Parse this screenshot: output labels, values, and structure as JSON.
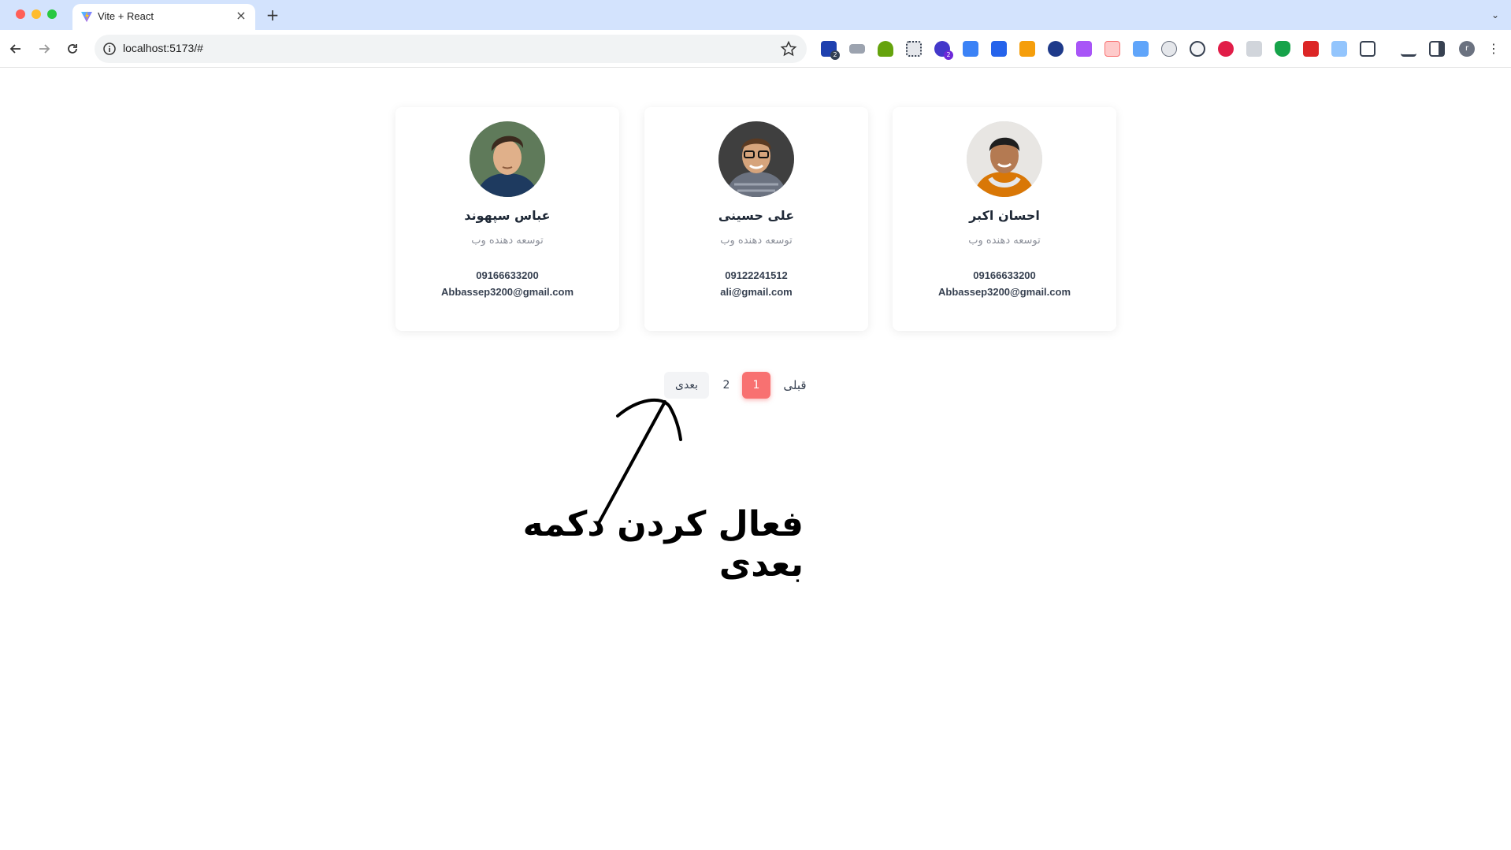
{
  "browser": {
    "tab_title": "Vite + React",
    "url": "localhost:5173/#",
    "colors": {
      "tabbar": "#d3e3fd",
      "toolbar": "#ffffff"
    },
    "extension_badges": {
      "first": "2",
      "fifth": "2"
    },
    "profile_initial": "r"
  },
  "cards": [
    {
      "name": "احسان اکبر",
      "role": "توسعه دهنده وب",
      "phone": "09166633200",
      "email": "Abbassep3200@gmail.com",
      "avatar_icon": "person-avatar"
    },
    {
      "name": "علی حسینی",
      "role": "توسعه دهنده وب",
      "phone": "09122241512",
      "email": "ali@gmail.com",
      "avatar_icon": "person-avatar"
    },
    {
      "name": "عباس سپهوند",
      "role": "توسعه دهنده وب",
      "phone": "09166633200",
      "email": "Abbassep3200@gmail.com",
      "avatar_icon": "person-avatar"
    }
  ],
  "pagination": {
    "prev_label": "قبلی",
    "pages": [
      "1",
      "2"
    ],
    "active_page": "1",
    "next_label": "بعدی",
    "accent_color": "#f87171"
  },
  "annotation": {
    "text": "فعال کردن دکمه بعدی"
  }
}
